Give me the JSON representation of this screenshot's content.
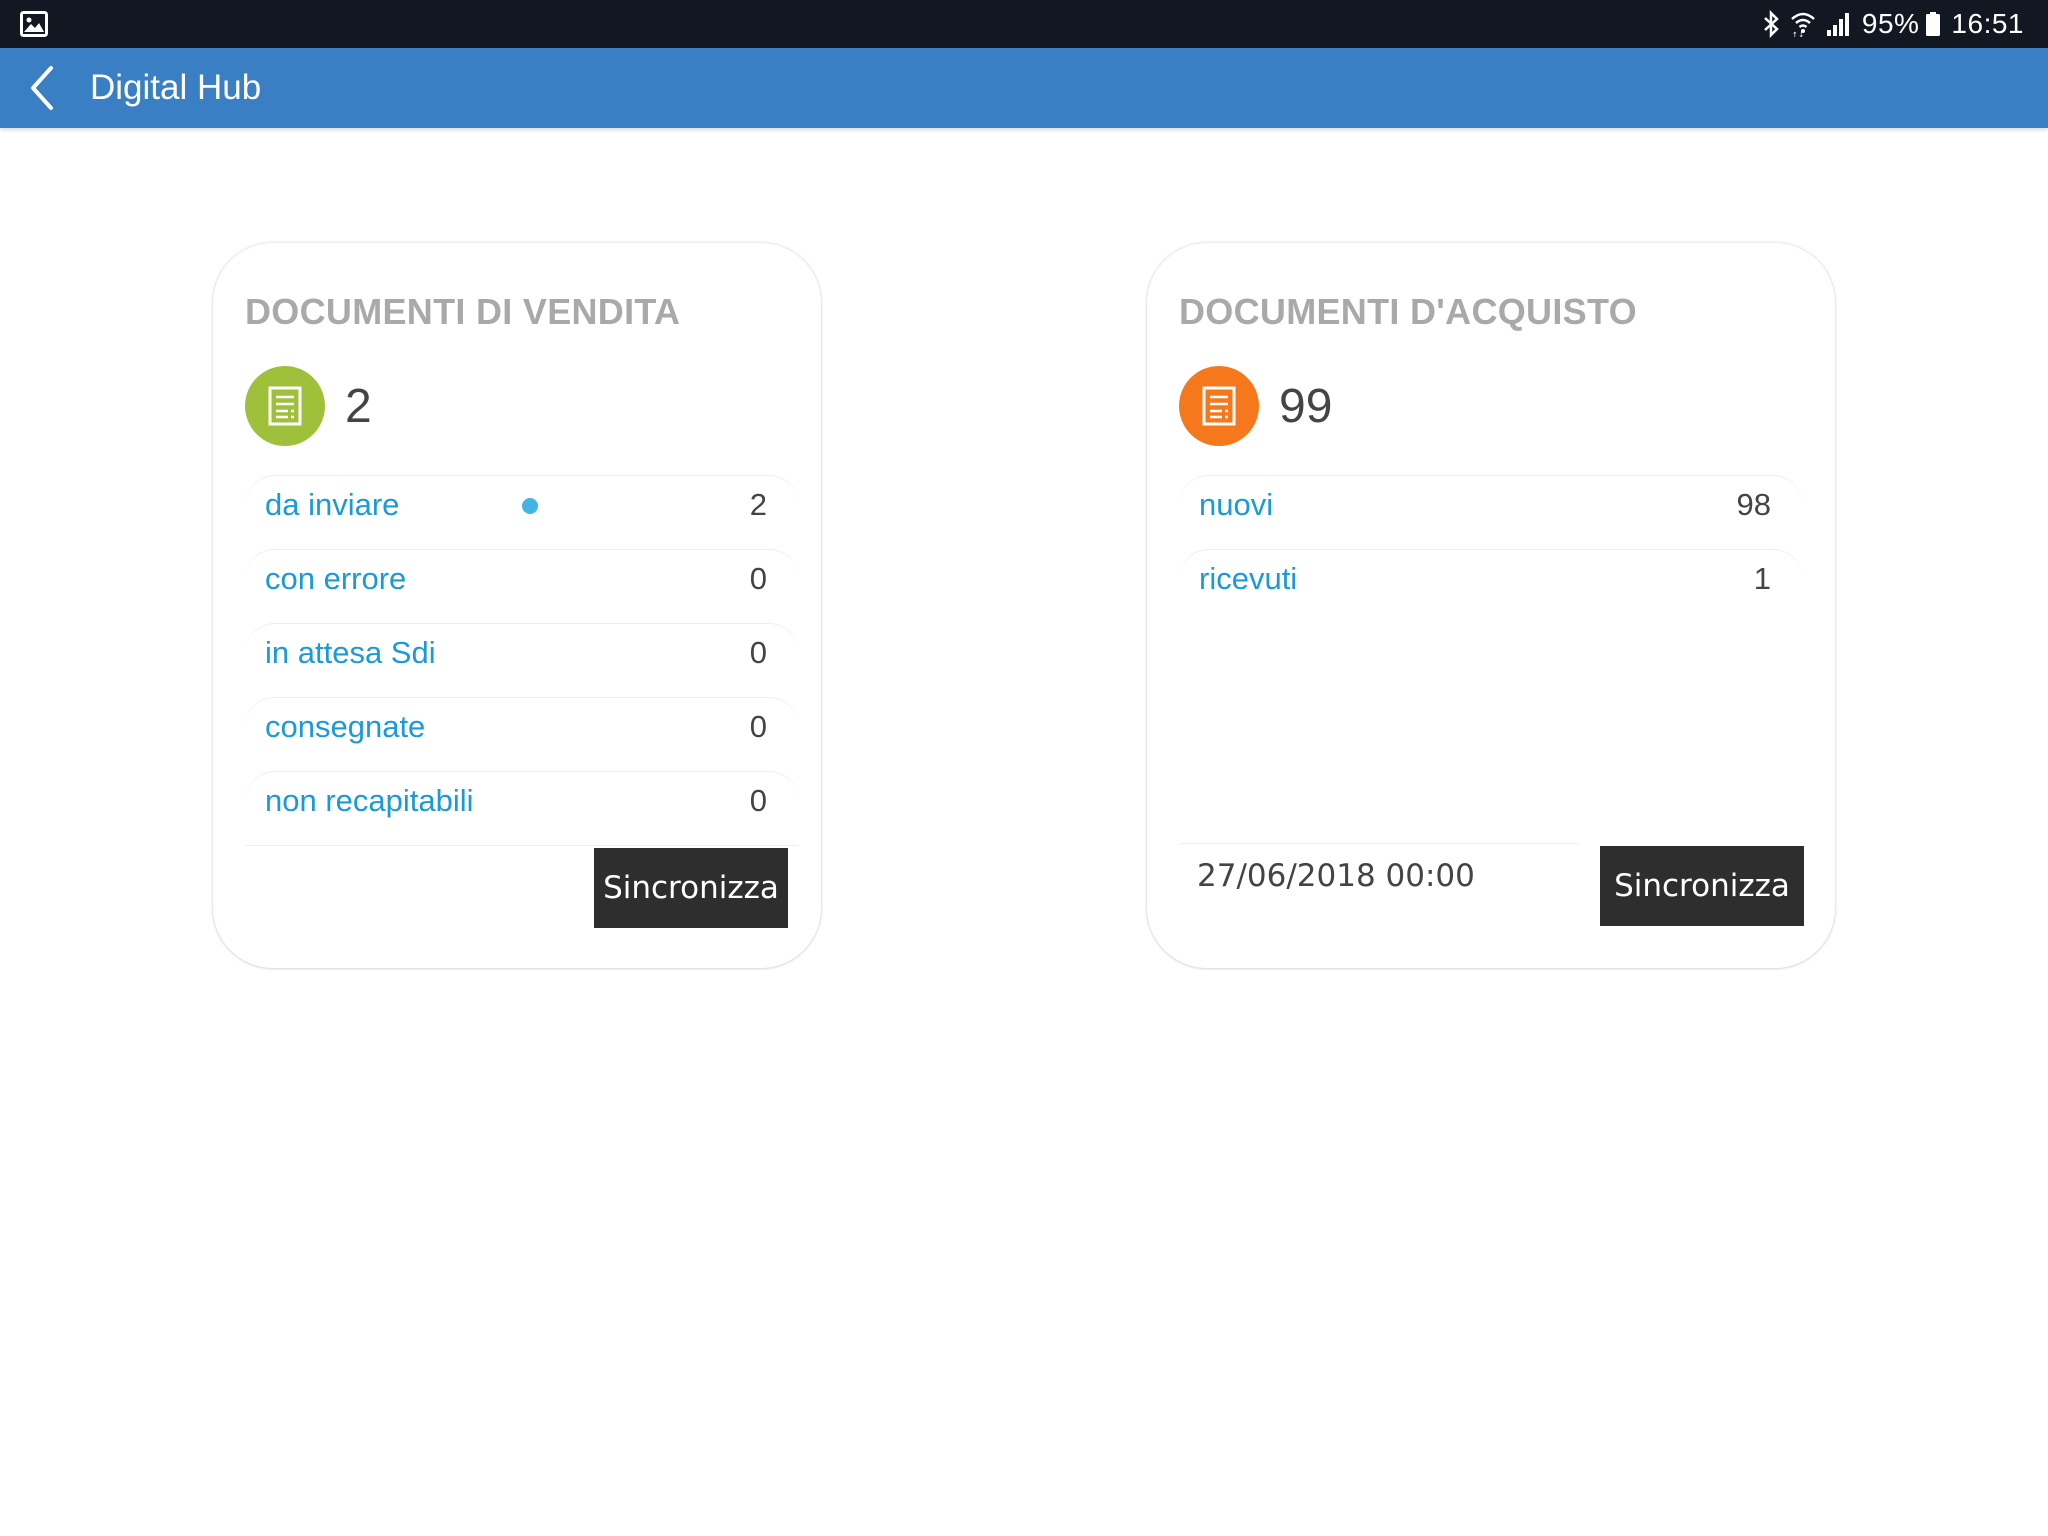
{
  "status_bar": {
    "left_icon": "image-gallery-icon",
    "battery_percent": "95%",
    "time": "16:51",
    "icons": [
      "bluetooth-icon",
      "wifi-icon",
      "signal-icon",
      "battery-icon"
    ]
  },
  "app_bar": {
    "back_icon": "chevron-left-icon",
    "title": "Digital Hub",
    "color": "#3a7fc4"
  },
  "sales": {
    "title": "DOCUMENTI DI VENDITA",
    "total": "2",
    "icon": "document-icon",
    "icon_color": "#9ec03a",
    "rows": [
      {
        "label": "da inviare",
        "count": "2",
        "indicator": "new-dot"
      },
      {
        "label": "con errore",
        "count": "0"
      },
      {
        "label": "in attesa Sdi",
        "count": "0"
      },
      {
        "label": "consegnate",
        "count": "0"
      },
      {
        "label": "non recapitabili",
        "count": "0"
      }
    ],
    "sync_label": "Sincronizza"
  },
  "purchase": {
    "title": "DOCUMENTI D'ACQUISTO",
    "total": "99",
    "icon": "document-icon",
    "icon_color": "#f6781c",
    "rows": [
      {
        "label": "nuovi",
        "count": "98"
      },
      {
        "label": "ricevuti",
        "count": "1"
      }
    ],
    "last_sync": "27/06/2018 00:00",
    "sync_label": "Sincronizza"
  },
  "colors": {
    "link": "#1b9ad8",
    "dot": "#41b6e6",
    "button": "#2e2e2e",
    "title_gray": "#a9a9a9"
  }
}
